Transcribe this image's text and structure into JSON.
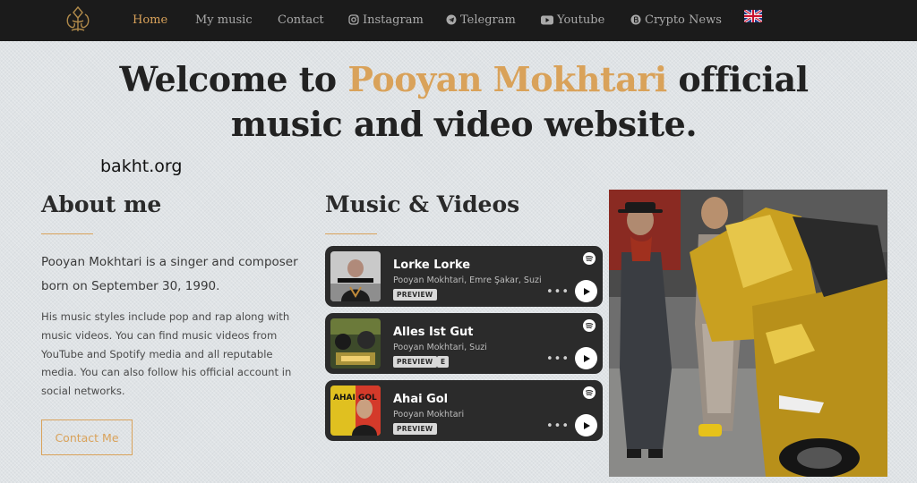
{
  "nav": {
    "items": [
      {
        "label": "Home",
        "active": true
      },
      {
        "label": "My music"
      },
      {
        "label": "Contact"
      },
      {
        "label": "Instagram",
        "icon": "instagram-icon"
      },
      {
        "label": "Telegram",
        "icon": "telegram-icon"
      },
      {
        "label": "Youtube",
        "icon": "youtube-icon"
      },
      {
        "label": "Crypto News",
        "icon": "bitcoin-icon"
      }
    ],
    "language_flag": "uk-flag-icon"
  },
  "hero": {
    "prefix": "Welcome to",
    "name": "Pooyan Mokhtari",
    "suffix_line1": "official",
    "line2": "music and video website."
  },
  "watermark": "bakht.org",
  "about": {
    "title": "About me",
    "lead": "Pooyan Mokhtari is a singer and composer born on September 30, 1990.",
    "body": "His music styles include pop and rap along with music videos. You can find music videos from YouTube and Spotify media and all reputable media. You can also follow his official account in social networks.",
    "button": "Contact Me"
  },
  "music": {
    "title": "Music & Videos",
    "tracks": [
      {
        "title": "Lorke Lorke",
        "artists": "Pooyan Mokhtari, Emre Şakar, Suzi",
        "badges": [
          "PREVIEW"
        ]
      },
      {
        "title": "Alles Ist Gut",
        "artists": "Pooyan Mokhtari, Suzi",
        "badges": [
          "PREVIEW",
          "E"
        ]
      },
      {
        "title": "Ahai Gol",
        "artists": "Pooyan Mokhtari",
        "badges": [
          "PREVIEW"
        ],
        "cover_text": "AHAI GOL"
      }
    ],
    "more_label": "•••"
  },
  "colors": {
    "accent": "#d9a25a",
    "nav_bg": "#1b1b1b",
    "card_bg": "#2b2b2b",
    "page_bg": "#dfe3e6"
  }
}
